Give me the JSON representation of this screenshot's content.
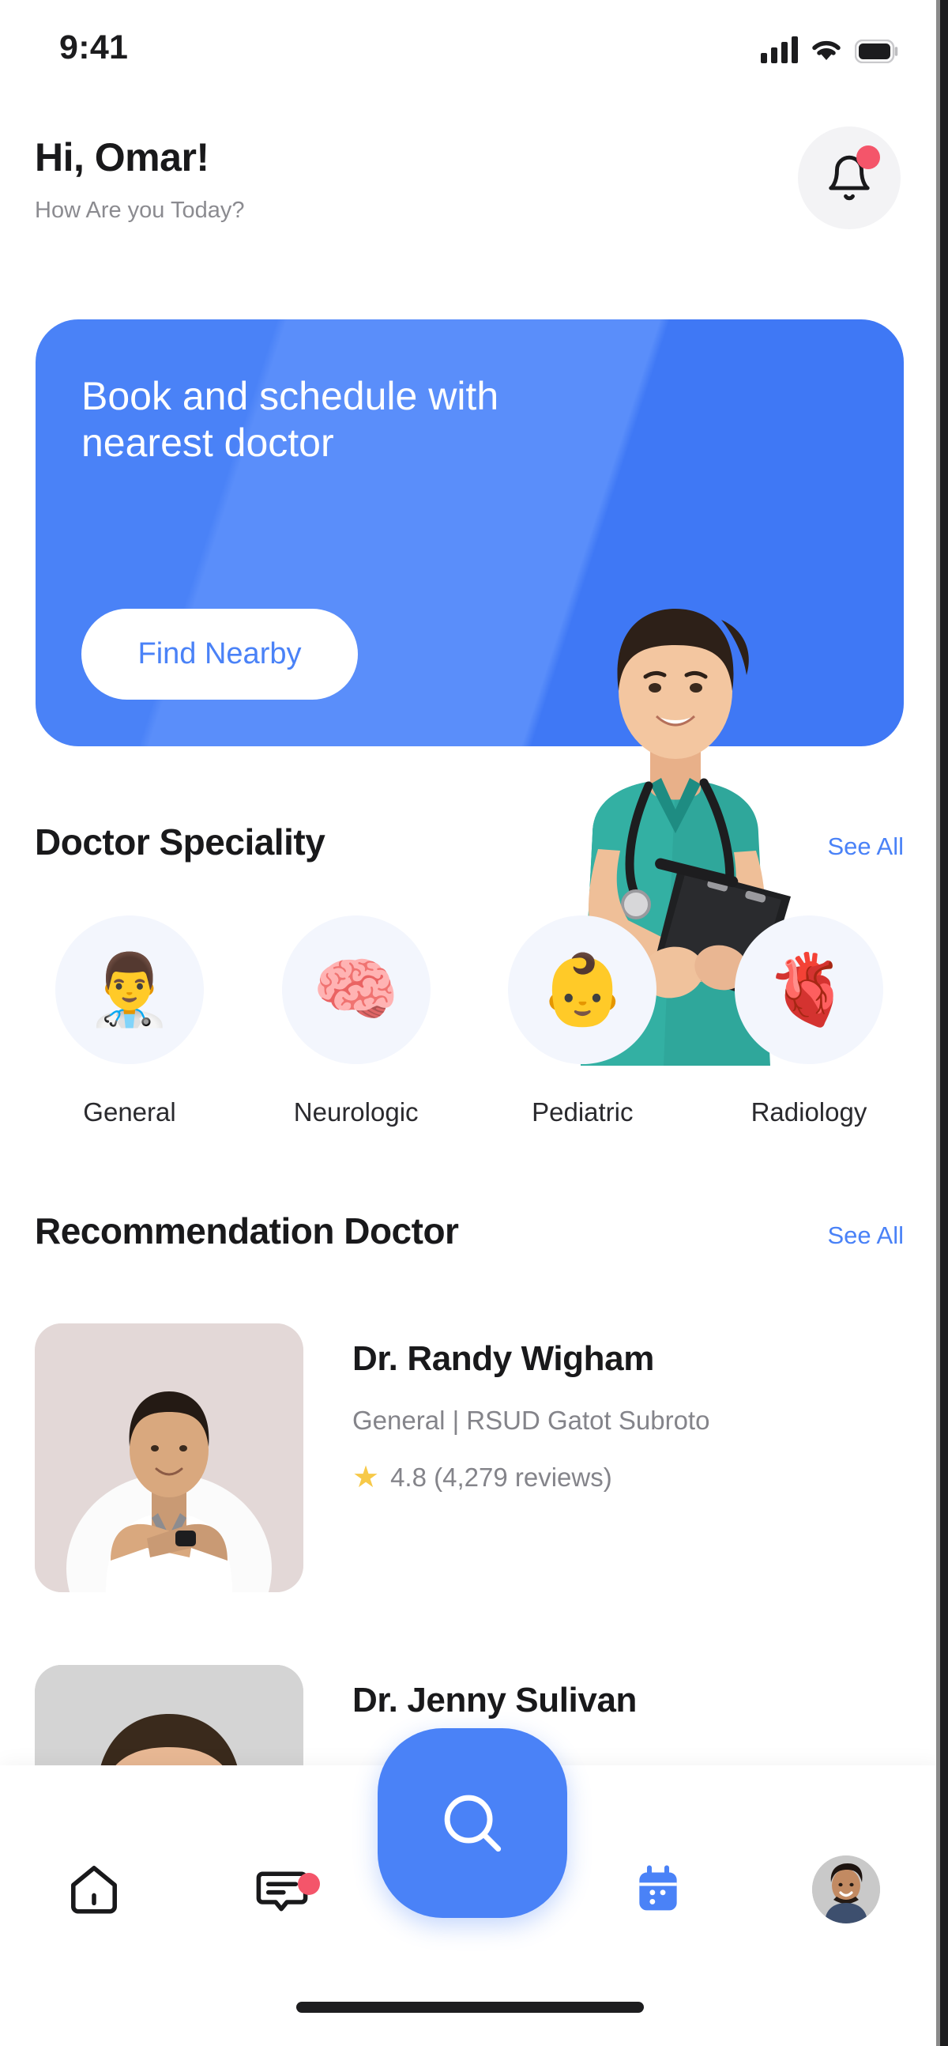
{
  "status_bar": {
    "time": "9:41",
    "signal_icon": "cellular-signal-icon",
    "wifi_icon": "wifi-icon",
    "battery_icon": "battery-full-icon"
  },
  "header": {
    "greeting": "Hi, Omar!",
    "subtitle": "How Are you Today?",
    "notification_icon": "bell-icon",
    "notification_badge_color": "#f4556a"
  },
  "banner": {
    "headline": "Book and schedule with nearest doctor",
    "cta_label": "Find Nearby",
    "background_color": "#4a82f7",
    "cta_text_color": "#4a82f7",
    "illustration": "nurse-with-clipboard-photo"
  },
  "speciality_section": {
    "title": "Doctor Speciality",
    "see_all_label": "See All",
    "items": [
      {
        "label": "General",
        "icon": "doctor-emoji-icon",
        "glyph": "👨‍⚕️"
      },
      {
        "label": "Neurologic",
        "icon": "brain-emoji-icon",
        "glyph": "🧠"
      },
      {
        "label": "Pediatric",
        "icon": "baby-emoji-icon",
        "glyph": "👶"
      },
      {
        "label": "Radiology",
        "icon": "kidneys-emoji-icon",
        "glyph": "🫀"
      }
    ]
  },
  "recommendation_section": {
    "title": "Recommendation Doctor",
    "see_all_label": "See All",
    "doctors": [
      {
        "name": "Dr. Randy Wigham",
        "speciality": "General",
        "separator": "|",
        "hospital": "RSUD Gatot Subroto",
        "meta": "General  |  RSUD Gatot Subroto",
        "rating": "4.8",
        "reviews": "(4,279 reviews)",
        "rating_line": "4.8 (4,279 reviews)",
        "star_icon": "star-icon",
        "photo": "doctor-portrait-photo"
      },
      {
        "name": "Dr. Jenny Sulivan",
        "name_visible_fragment": "Sulivan",
        "photo": "doctor-portrait-photo"
      }
    ]
  },
  "bottom_nav": {
    "items": [
      {
        "icon": "home-icon",
        "active": "false"
      },
      {
        "icon": "chat-bubble-icon",
        "active": "false",
        "badge": "true"
      },
      {
        "icon": "calendar-icon",
        "active": "true"
      },
      {
        "icon": "profile-avatar-icon",
        "active": "false"
      }
    ],
    "fab": {
      "icon": "search-icon",
      "color": "#4a82f7"
    },
    "active_color": "#4a82f7",
    "inactive_color": "#19191b"
  },
  "home_indicator": {
    "visible": "true"
  }
}
